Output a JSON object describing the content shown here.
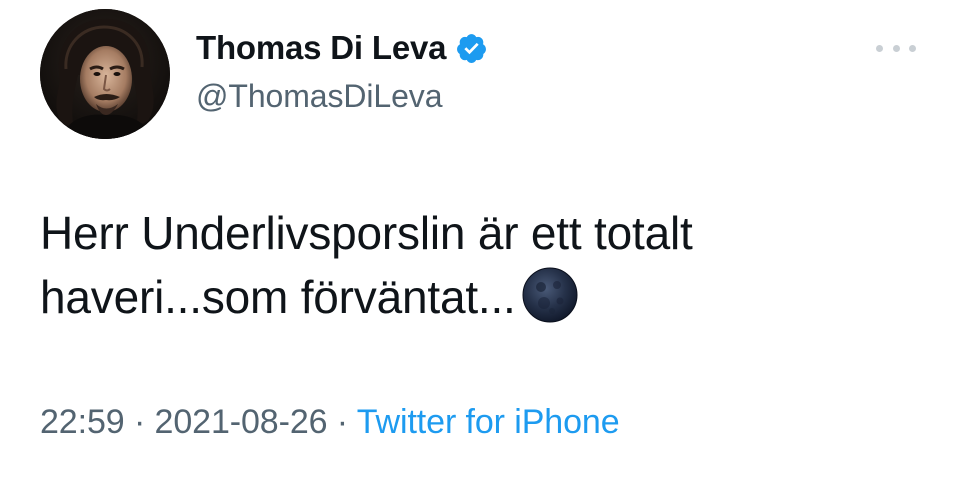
{
  "author": {
    "display_name": "Thomas Di Leva",
    "handle": "@ThomasDiLeva",
    "verified": true
  },
  "tweet": {
    "lines": [
      "Herr Underlivsporslin är ett totalt",
      "haveri...som förväntat..."
    ],
    "emoji": "new-moon-face"
  },
  "meta": {
    "time": "22:59",
    "separator": " · ",
    "date": "2021-08-26",
    "source": "Twitter for iPhone"
  },
  "icons": {
    "verified": "verified-badge-icon",
    "more": "more-options-icon"
  },
  "colors": {
    "verified_blue": "#1d9bf0",
    "secondary_text": "#536471",
    "link": "#1d9bf0"
  }
}
